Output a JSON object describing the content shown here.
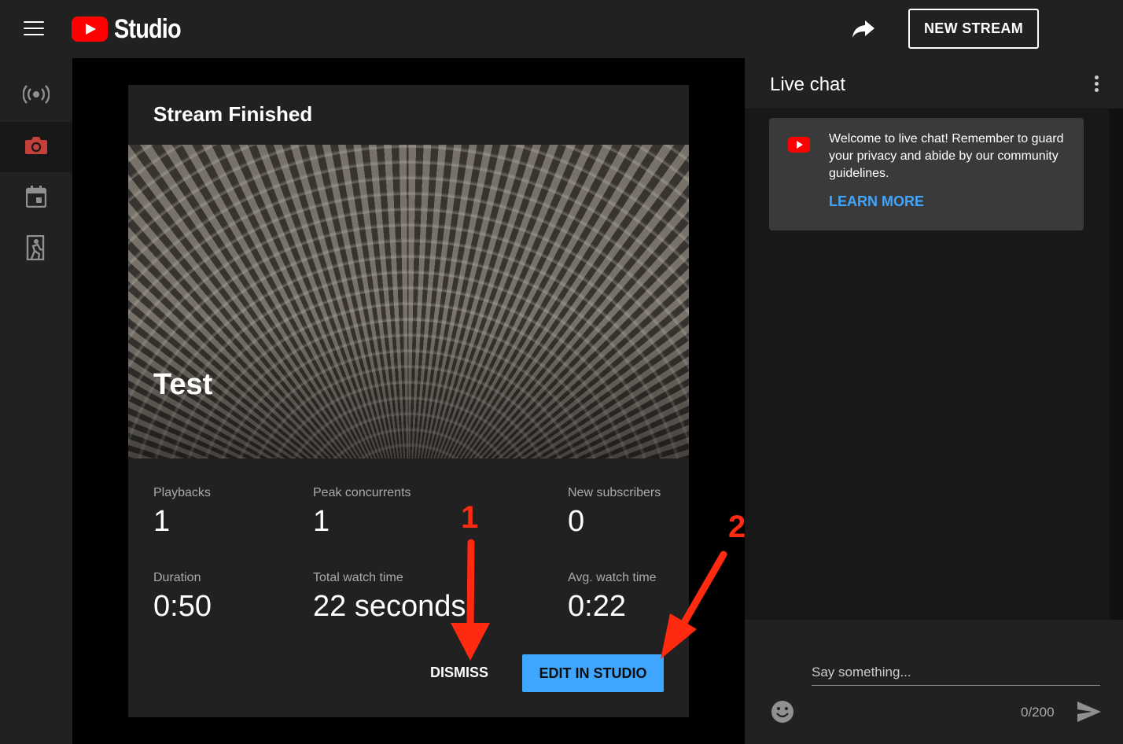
{
  "header": {
    "logo_text": "Studio",
    "new_stream_label": "NEW STREAM",
    "icons": [
      "hamburger-icon",
      "share-icon"
    ]
  },
  "rail": {
    "icons": [
      "live-broadcast-icon",
      "camera-icon",
      "calendar-icon",
      "exit-icon"
    ],
    "active": "camera-icon",
    "active_color": "#ff4e45"
  },
  "card": {
    "title": "Stream Finished",
    "thumbnail_title": "Test",
    "stats": [
      {
        "label": "Playbacks",
        "value": "1"
      },
      {
        "label": "Peak concurrents",
        "value": "1"
      },
      {
        "label": "New subscribers",
        "value": "0"
      },
      {
        "label": "Duration",
        "value": "0:50"
      },
      {
        "label": "Total watch time",
        "value": "22 seconds"
      },
      {
        "label": "Avg. watch time",
        "value": "0:22"
      }
    ],
    "dismiss_label": "DISMISS",
    "edit_label": "EDIT IN STUDIO",
    "edit_color": "#3ea6ff"
  },
  "chat": {
    "title": "Live chat",
    "welcome_text": "Welcome to live chat! Remember to guard your privacy and abide by our community guidelines.",
    "learn_more": "LEARN MORE",
    "input_placeholder": "Say something...",
    "counter": "0/200"
  },
  "annotations": {
    "labels": [
      "1",
      "2"
    ],
    "color": "#ff2a10"
  }
}
